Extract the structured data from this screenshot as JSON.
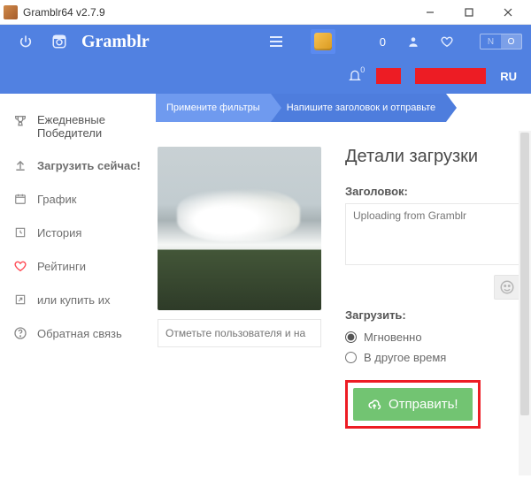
{
  "titlebar": {
    "title": "Gramblr64 v2.7.9"
  },
  "topbar": {
    "brand": "Gramblr",
    "coin_count": "0",
    "lang": "RU",
    "switch_left": "N",
    "switch_right": "O",
    "notif_count": "0"
  },
  "sidebar": {
    "items": [
      {
        "label": "Ежедневные Победители",
        "icon": "trophy"
      },
      {
        "label": "Загрузить сейчас!",
        "icon": "upload"
      },
      {
        "label": "График",
        "icon": "calendar"
      },
      {
        "label": "История",
        "icon": "history"
      },
      {
        "label": "Рейтинги",
        "icon": "heart"
      },
      {
        "label": "или купить их",
        "icon": "share"
      },
      {
        "label": "Обратная связь",
        "icon": "help"
      }
    ]
  },
  "crumbs": {
    "step1": "Примените фильтры",
    "step2": "Напишите заголовок и отправьте"
  },
  "compose": {
    "tag_placeholder": "Отметьте пользователя и на",
    "panel_title": "Детали загрузки",
    "caption_label": "Заголовок:",
    "caption_value": "Uploading from Gramblr",
    "upload_label": "Загрузить:",
    "radio_now": "Мгновенно",
    "radio_later": "В другое время",
    "send_label": "Отправить!"
  }
}
